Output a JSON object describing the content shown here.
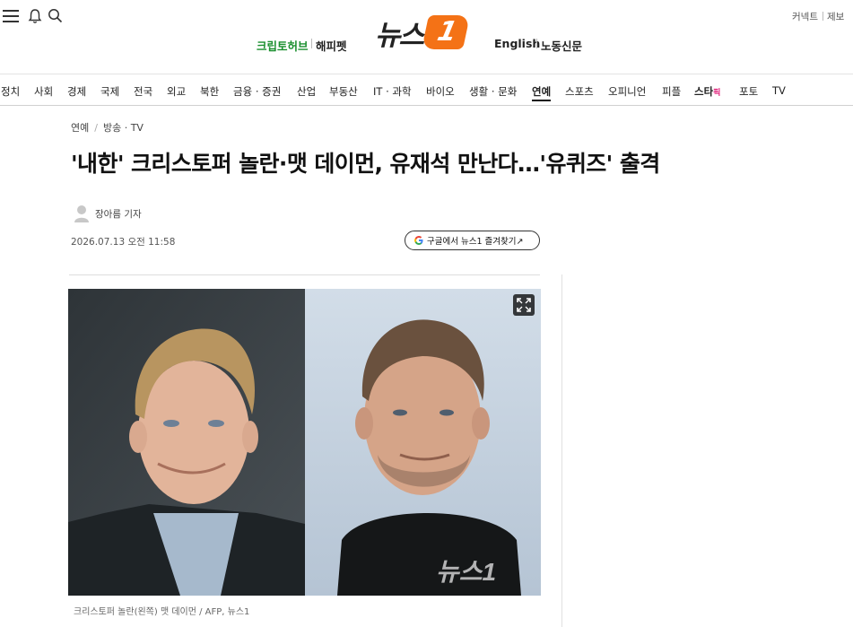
{
  "header": {
    "left_links": [
      "크립토허브",
      "해피펫"
    ],
    "logo_text": "뉴스",
    "logo_badge": "1",
    "right_links": [
      "English",
      "노동신문"
    ],
    "util_links": [
      "커넥트",
      "제보"
    ],
    "icons": [
      "menu-icon",
      "bell-icon",
      "search-icon"
    ]
  },
  "nav": {
    "items": [
      "정치",
      "사회",
      "경제",
      "국제",
      "전국",
      "외교",
      "북한",
      "금융 · 증권",
      "산업",
      "부동산",
      "IT · 과학",
      "바이오",
      "생활 · 문화",
      "연예",
      "스포츠",
      "오피니언",
      "피플"
    ],
    "star_label": "스타",
    "star_sup": "픽",
    "extra_items": [
      "포토",
      "TV"
    ],
    "active": "연예"
  },
  "article": {
    "breadcrumb": [
      "연예",
      "방송 · TV"
    ],
    "headline": "'내한' 크리스토퍼 놀란·맷 데이먼, 유재석 만난다…'유퀴즈' 출격",
    "reporter": "장아름 기자",
    "date": "2026.07.13 오전 11:58",
    "google_button": "구글에서 뉴스1 즐겨찾기↗",
    "caption": "크리스토퍼 놀란(왼쪽) 맷 데이먼 / AFP, 뉴스1",
    "watermark": "뉴스1"
  },
  "colors": {
    "brand_orange": "#f47216",
    "hub_green": "#1a8f2e",
    "star_pink": "#e0207a"
  }
}
